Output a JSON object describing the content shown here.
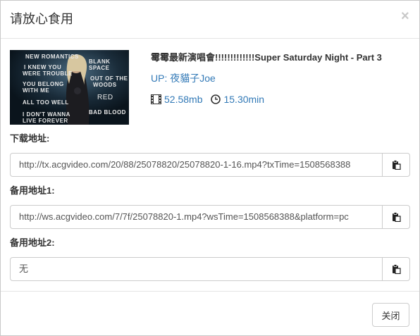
{
  "dialog": {
    "title": "请放心食用",
    "close_glyph": "×"
  },
  "video": {
    "title": "霉霉最新演唱會!!!!!!!!!!!!!Super Saturday Night - Part 3",
    "uploader_prefix": "UP:",
    "uploader_name": "夜貓子Joe",
    "size": "52.58mb",
    "duration": "15.30min",
    "thumbnail_text": {
      "line1": "NEW ROMANTICS",
      "line2": "I KNEW YOU",
      "line3": "WERE TROUBLE",
      "line4": "YOU BELONG",
      "line5": "WITH ME",
      "line6": "ALL TOO WELL",
      "line7": "I DON'T WANNA",
      "line8": "LIVE FOREVER",
      "right1": "BLANK SPACE",
      "right2": "OUT OF THE",
      "right3": "WOODS",
      "right4": "RED",
      "right5": "BAD BLOOD"
    }
  },
  "links": [
    {
      "label": "下载地址:",
      "value": "http://tx.acgvideo.com/20/88/25078820/25078820-1-16.mp4?txTime=1508568388"
    },
    {
      "label": "备用地址1:",
      "value": "http://ws.acgvideo.com/7/7f/25078820-1.mp4?wsTime=1508568388&platform=pc"
    },
    {
      "label": "备用地址2:",
      "value": "无"
    }
  ],
  "footer": {
    "close_label": "关闭"
  },
  "icons": {
    "film": "film-icon",
    "clock": "clock-icon",
    "clipboard": "clipboard-icon"
  }
}
